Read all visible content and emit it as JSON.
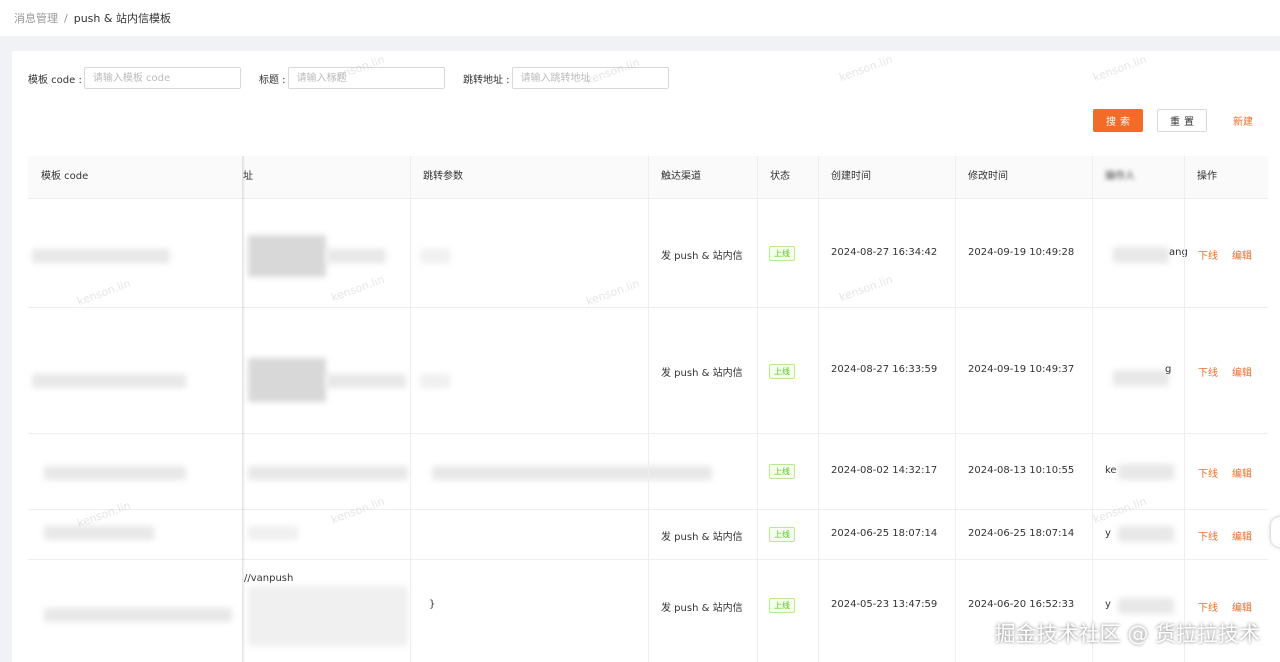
{
  "breadcrumb": {
    "parent": "消息管理",
    "separator": "/",
    "current": "push & 站内信模板"
  },
  "filters": {
    "template_code_label": "模板 code :",
    "template_code_placeholder": "请输入模板 code",
    "title_label": "标题 :",
    "title_placeholder": "请输入标题",
    "jump_url_label": "跳转地址 :",
    "jump_url_placeholder": "请输入跳转地址"
  },
  "actions": {
    "search": "搜索",
    "reset": "重置",
    "create": "新建"
  },
  "table": {
    "headers": [
      "模板 code",
      "址",
      "跳转参数",
      "触达渠道",
      "状态",
      "创建时间",
      "修改时间",
      "操作人",
      "操作"
    ],
    "rows": [
      {
        "channel": "发 push & 站内信",
        "status": "上线",
        "created": "2024-08-27 16:34:42",
        "modified": "2024-09-19 10:49:28",
        "operator_fragment": "ang",
        "op_offline": "下线",
        "op_edit": "编辑"
      },
      {
        "channel": "发 push & 站内信",
        "status": "上线",
        "created": "2024-08-27 16:33:59",
        "modified": "2024-09-19 10:49:37",
        "operator_fragment": "g",
        "op_offline": "下线",
        "op_edit": "编辑"
      },
      {
        "channel": "",
        "status": "上线",
        "created": "2024-08-02 14:32:17",
        "modified": "2024-08-13 10:10:55",
        "operator_fragment": "ke",
        "op_offline": "下线",
        "op_edit": "编辑"
      },
      {
        "channel": "发 push & 站内信",
        "status": "上线",
        "created": "2024-06-25 18:07:14",
        "modified": "2024-06-25 18:07:14",
        "operator_fragment": "y",
        "op_offline": "下线",
        "op_edit": "编辑"
      },
      {
        "channel": "发 push & 站内信",
        "status": "上线",
        "created": "2024-05-23 13:47:59",
        "modified": "2024-06-20 16:52:33",
        "operator_fragment": "y",
        "op_offline": "下线",
        "op_edit": "编辑"
      }
    ],
    "row5_url_fragment": "//vanpush",
    "row5_param_fragment": "}"
  },
  "watermark_text": "kenson.lin",
  "footer_mark": "掘金技术社区 @ 货拉拉技术",
  "colors": {
    "accent": "#f26b27",
    "status_green": "#52c41a"
  }
}
